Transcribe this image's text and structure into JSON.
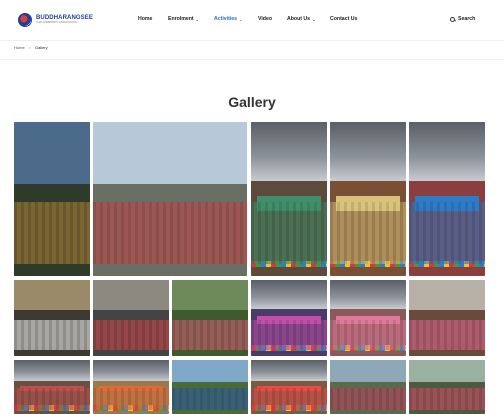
{
  "brand": {
    "name": "BUDDHARANGSEE",
    "subtitle": "THAI COMMUNITY ASSOCIATION",
    "accent": "#2a6ec7",
    "primary": "#1e3f99"
  },
  "nav": {
    "items": [
      {
        "label": "Home",
        "dropdown": false,
        "active": false
      },
      {
        "label": "Enrolment",
        "dropdown": true,
        "active": false
      },
      {
        "label": "Activities",
        "dropdown": true,
        "active": true
      },
      {
        "label": "Video",
        "dropdown": false,
        "active": false
      },
      {
        "label": "About Us",
        "dropdown": true,
        "active": false
      },
      {
        "label": "Contact Us",
        "dropdown": false,
        "active": false
      }
    ],
    "search_label": "Search",
    "search_icon": "search-icon",
    "dropdown_icon": "chevron-down-icon"
  },
  "breadcrumb": {
    "home": "Home",
    "separator": ">",
    "current": "Gallery"
  },
  "page": {
    "title": "Gallery"
  },
  "gallery": {
    "photos": [
      {
        "id": "p1",
        "scene": "crowd-outdoor",
        "palette": [
          "#4c6a8a",
          "#2f3b2a",
          "#b8863a"
        ]
      },
      {
        "id": "p2",
        "scene": "group-photo",
        "palette": [
          "#b7c9d8",
          "#6a6f66",
          "#c74242"
        ]
      },
      {
        "id": "p3",
        "scene": "stage-tent",
        "palette": [
          "#6b7078",
          "#5d4a3a",
          "#3f8f6a"
        ]
      },
      {
        "id": "p4",
        "scene": "stage-tent",
        "palette": [
          "#5f646c",
          "#7a4f35",
          "#d9c27a"
        ]
      },
      {
        "id": "p5",
        "scene": "stage-tent",
        "palette": [
          "#5a5f66",
          "#8a3e3e",
          "#2e7bc7"
        ]
      },
      {
        "id": "p6",
        "scene": "crowd-outdoor",
        "palette": [
          "#9a8a6a",
          "#3e3a33",
          "#ffffff"
        ]
      },
      {
        "id": "p7",
        "scene": "crowd-outdoor",
        "palette": [
          "#8c8a80",
          "#444",
          "#d94848"
        ]
      },
      {
        "id": "p8",
        "scene": "dancers",
        "palette": [
          "#6e8a5a",
          "#3f5a2e",
          "#e0607a"
        ]
      },
      {
        "id": "p9",
        "scene": "stage-tent",
        "palette": [
          "#55606e",
          "#4a3b6a",
          "#c24ea8"
        ]
      },
      {
        "id": "p10",
        "scene": "stage-tent",
        "palette": [
          "#6a6f78",
          "#8a5a5a",
          "#e07a9a"
        ]
      },
      {
        "id": "p11",
        "scene": "dancers",
        "palette": [
          "#b6b0a6",
          "#6a4a3a",
          "#e86a9a"
        ]
      },
      {
        "id": "p12",
        "scene": "stage-tent",
        "palette": [
          "#5e636b",
          "#6a5040",
          "#c05050"
        ]
      },
      {
        "id": "p13",
        "scene": "stage-tent",
        "palette": [
          "#c8c2b0",
          "#9a7a4a",
          "#e06a3a"
        ]
      },
      {
        "id": "p14",
        "scene": "crowd-outdoor",
        "palette": [
          "#7fa7c8",
          "#4a6a3a",
          "#2a5aa8"
        ]
      },
      {
        "id": "p15",
        "scene": "stage-tent",
        "palette": [
          "#6e737b",
          "#7a5a40",
          "#e84a4a"
        ]
      },
      {
        "id": "p16",
        "scene": "crowd-outdoor",
        "palette": [
          "#8ea8b8",
          "#5a6a4a",
          "#c04060"
        ]
      },
      {
        "id": "p17",
        "scene": "crowd-outdoor",
        "palette": [
          "#9ab0a0",
          "#4e5a40",
          "#d84a6a"
        ]
      }
    ]
  }
}
